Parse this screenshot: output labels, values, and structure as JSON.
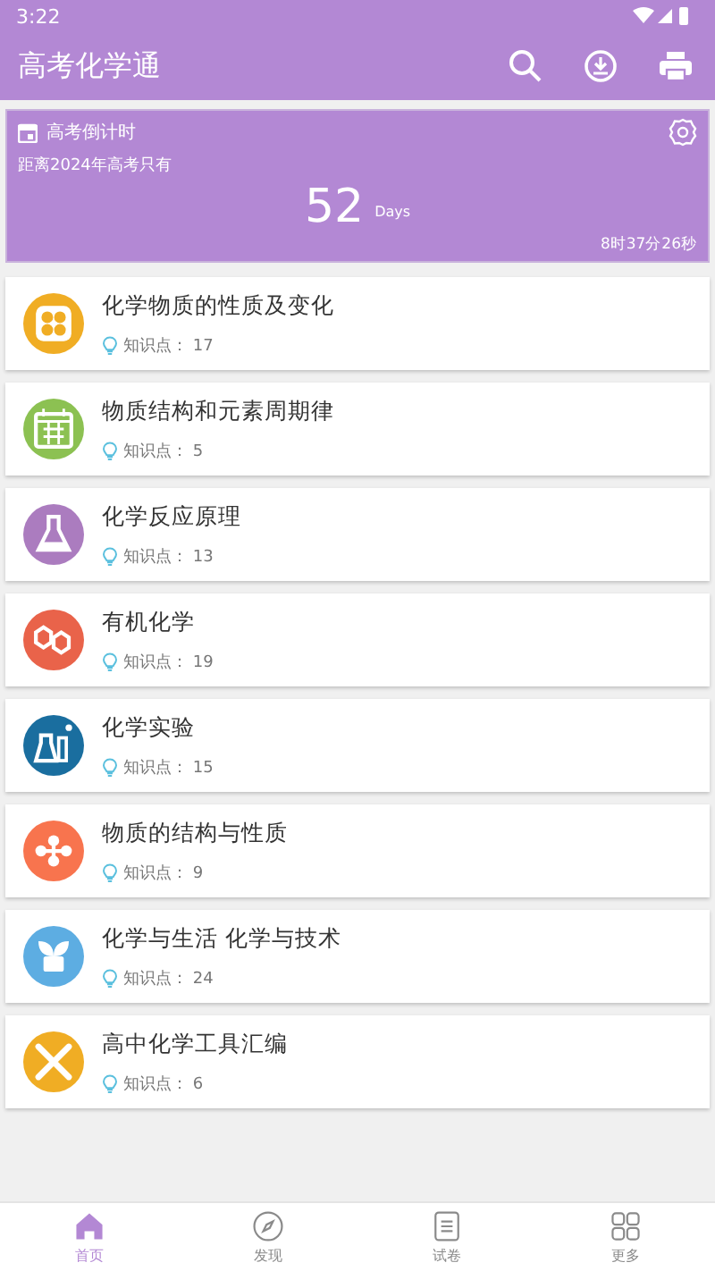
{
  "status_bar": {
    "time": "3:22"
  },
  "app_bar": {
    "title": "高考化学通"
  },
  "countdown": {
    "title": "高考倒计时",
    "subtitle": "距离2024年高考只有",
    "days": "52",
    "unit": "Days",
    "time_left": "8时37分26秒"
  },
  "topics": [
    {
      "title": "化学物质的性质及变化",
      "label": "知识点：",
      "count": "17",
      "color": "#f0ad24"
    },
    {
      "title": "物质结构和元素周期律",
      "label": "知识点：",
      "count": "5",
      "color": "#8cc152"
    },
    {
      "title": "化学反应原理",
      "label": "知识点：",
      "count": "13",
      "color": "#ab7cbf"
    },
    {
      "title": "有机化学",
      "label": "知识点：",
      "count": "19",
      "color": "#e9634a"
    },
    {
      "title": "化学实验",
      "label": "知识点：",
      "count": "15",
      "color": "#1a6e9f"
    },
    {
      "title": "物质的结构与性质",
      "label": "知识点：",
      "count": "9",
      "color": "#f8744e"
    },
    {
      "title": "化学与生活 化学与技术",
      "label": "知识点：",
      "count": "24",
      "color": "#5dade2"
    },
    {
      "title": "高中化学工具汇编",
      "label": "知识点：",
      "count": "6",
      "color": "#f0ad24"
    }
  ],
  "bottom_nav": [
    {
      "label": "首页",
      "selected": true
    },
    {
      "label": "发现",
      "selected": false
    },
    {
      "label": "试卷",
      "selected": false
    },
    {
      "label": "更多",
      "selected": false
    }
  ]
}
